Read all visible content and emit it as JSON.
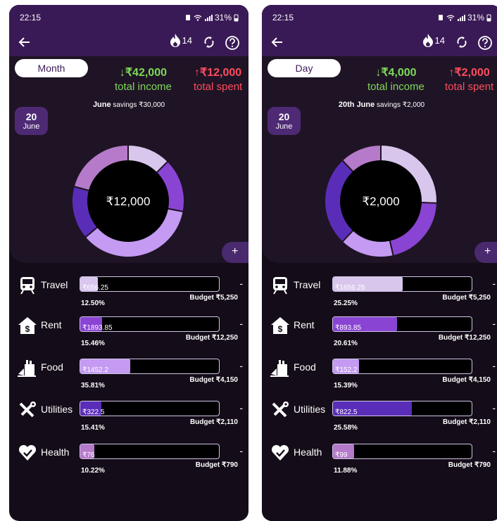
{
  "colors": {
    "header": "#3a1a56",
    "income": "#7ed957",
    "spent": "#ff4d5e",
    "travel": "#d8c6ec",
    "rent": "#8a44d4",
    "food": "#c49af2",
    "utilities": "#5a2db8",
    "health": "#b57ac9"
  },
  "screens": [
    {
      "status": {
        "time": "22:15",
        "battery": "31%"
      },
      "streak": "14",
      "period": "Month",
      "income": {
        "amount": "₹42,000",
        "label": "total income"
      },
      "spent": {
        "amount": "₹12,000",
        "label": "total spent"
      },
      "savings": {
        "prefix": "June",
        "text": "savings ₹30,000"
      },
      "date": {
        "day": "20",
        "month": "June"
      },
      "donut_center": "₹12,000",
      "add_label": "+",
      "categories": [
        {
          "name": "Travel",
          "value": "₹656.25",
          "pct": "12.50%",
          "budget": "Budget ₹5,250",
          "fill": 0.125,
          "dash": "-"
        },
        {
          "name": "Rent",
          "value": "₹1893.85",
          "pct": "15.46%",
          "budget": "Budget ₹12,250",
          "fill": 0.155,
          "dash": "-"
        },
        {
          "name": "Food",
          "value": "₹1452.2",
          "pct": "35.81%",
          "budget": "Budget ₹4,150",
          "fill": 0.358,
          "dash": "-"
        },
        {
          "name": "Utilities",
          "value": "₹322.5",
          "pct": "15.41%",
          "budget": "Budget ₹2,110",
          "fill": 0.154,
          "dash": "-"
        },
        {
          "name": "Health",
          "value": "₹76",
          "pct": "10.22%",
          "budget": "Budget ₹790",
          "fill": 0.102,
          "dash": "-"
        }
      ],
      "donut_slices": [
        {
          "category": "Travel",
          "share": 0.125,
          "color": "#d8c6ec"
        },
        {
          "category": "Rent",
          "share": 0.155,
          "color": "#8a44d4"
        },
        {
          "category": "Food",
          "share": 0.358,
          "color": "#c49af2"
        },
        {
          "category": "Utilities",
          "share": 0.154,
          "color": "#5a2db8"
        },
        {
          "category": "Health",
          "share": 0.208,
          "color": "#b57ac9"
        }
      ]
    },
    {
      "status": {
        "time": "22:15",
        "battery": "31%"
      },
      "streak": "14",
      "period": "Day",
      "income": {
        "amount": "₹4,000",
        "label": "total income"
      },
      "spent": {
        "amount": "₹2,000",
        "label": "total spent"
      },
      "savings": {
        "prefix": "20th June",
        "text": "savings ₹2,000"
      },
      "date": {
        "day": "20",
        "month": "June"
      },
      "donut_center": "₹2,000",
      "add_label": "+",
      "categories": [
        {
          "name": "Travel",
          "value": "₹1656.25",
          "pct": "25.25%",
          "budget": "Budget ₹5,250",
          "fill": 0.5,
          "dash": "-"
        },
        {
          "name": "Rent",
          "value": "₹893.85",
          "pct": "20.61%",
          "budget": "Budget ₹12,250",
          "fill": 0.46,
          "dash": "-"
        },
        {
          "name": "Food",
          "value": "₹152.2",
          "pct": "15.39%",
          "budget": "Budget ₹4,150",
          "fill": 0.19,
          "dash": "-"
        },
        {
          "name": "Utilities",
          "value": "₹822.5",
          "pct": "25.58%",
          "budget": "Budget ₹2,110",
          "fill": 0.57,
          "dash": "-"
        },
        {
          "name": "Health",
          "value": "₹99",
          "pct": "11.88%",
          "budget": "Budget ₹790",
          "fill": 0.15,
          "dash": "-"
        }
      ],
      "donut_slices": [
        {
          "category": "Travel",
          "share": 0.2525,
          "color": "#d8c6ec"
        },
        {
          "category": "Rent",
          "share": 0.2061,
          "color": "#8a44d4"
        },
        {
          "category": "Food",
          "share": 0.1539,
          "color": "#c49af2"
        },
        {
          "category": "Utilities",
          "share": 0.2558,
          "color": "#5a2db8"
        },
        {
          "category": "Health",
          "share": 0.1188,
          "color": "#b57ac9"
        }
      ]
    }
  ]
}
